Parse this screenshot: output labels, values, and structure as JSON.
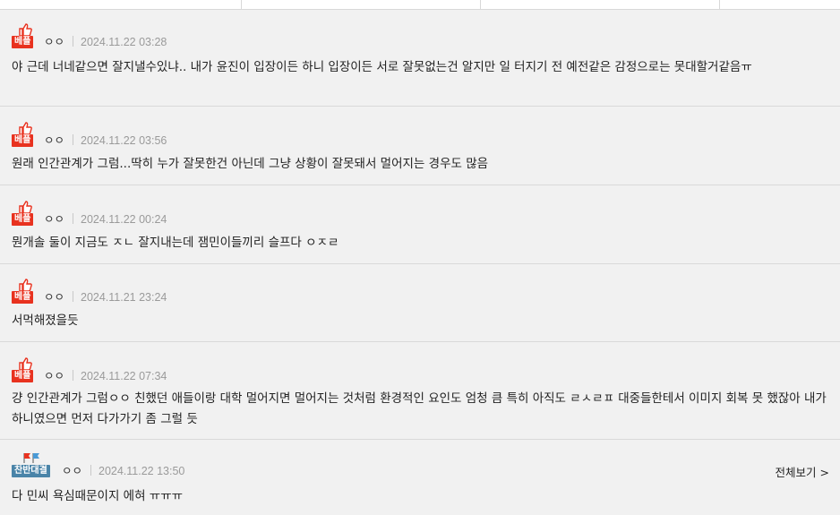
{
  "comments": [
    {
      "badge": "베플",
      "badge_color": "#e8321f",
      "author": "ㅇㅇ",
      "date": "2024.11.22 03:28",
      "text": "야 근데 너네같으면 잘지낼수있냐.. 내가 윤진이 입장이든 하니 입장이든 서로 잘못없는건 알지만 일 터지기 전 예전같은 감정으로는 못대할거같음ㅠ"
    },
    {
      "badge": "베플",
      "badge_color": "#e8321f",
      "author": "ㅇㅇ",
      "date": "2024.11.22 03:56",
      "text": "원래 인간관계가 그럼...딱히 누가 잘못한건 아닌데 그냥 상황이 잘못돼서 멀어지는 경우도 많음"
    },
    {
      "badge": "베플",
      "badge_color": "#e8321f",
      "author": "ㅇㅇ",
      "date": "2024.11.22 00:24",
      "text": "뭔개솔 둘이 지금도 ㅈㄴ 잘지내는데 잼민이들끼리 슬프다 ㅇㅈㄹ"
    },
    {
      "badge": "베플",
      "badge_color": "#e8321f",
      "author": "ㅇㅇ",
      "date": "2024.11.21 23:24",
      "text": "서먹해졌을듯"
    },
    {
      "badge": "베플",
      "badge_color": "#e8321f",
      "author": "ㅇㅇ",
      "date": "2024.11.22 07:34",
      "text": "걍 인간관계가 그럼ㅇㅇ 친했던 애들이랑 대학 멀어지면 멀어지는 것처럼 환경적인 요인도 엄청 큼 특히 아직도 ㄹㅅㄹㅍ 대중들한테서 이미지 회복 못 했잖아 내가 하니였으면 먼저 다가가기 좀 그럴 듯"
    },
    {
      "badge": "찬반대결",
      "badge_color": "#4a84a8",
      "author": "ㅇㅇ",
      "date": "2024.11.22 13:50",
      "more": "전체보기 >",
      "text": "다 민씨 욕심때문이지 에혀 ㅠㅠㅠ"
    }
  ]
}
